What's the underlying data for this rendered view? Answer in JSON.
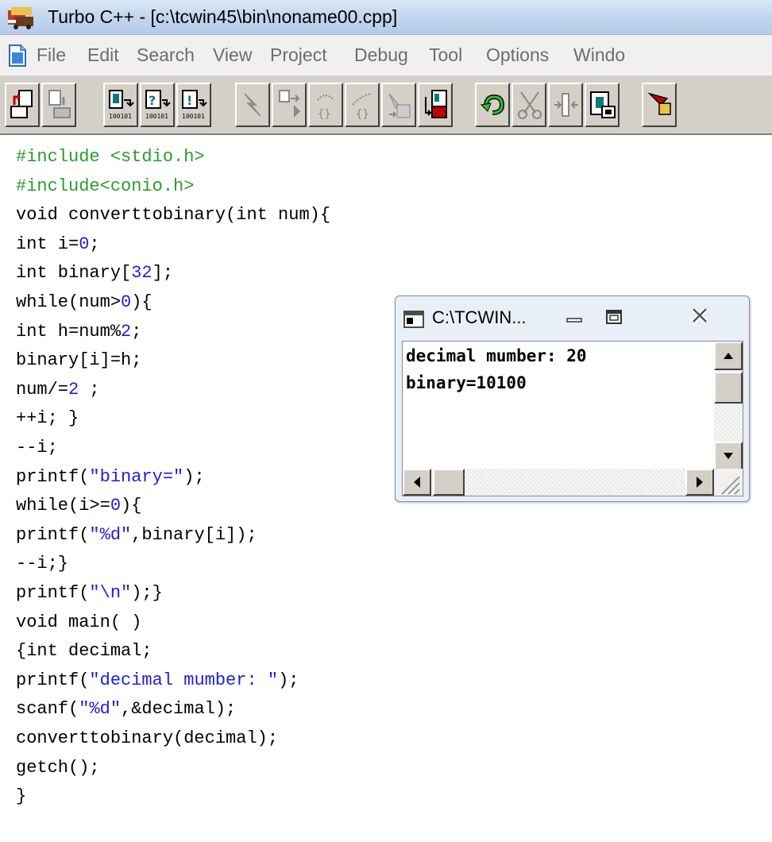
{
  "window": {
    "title": "Turbo C++ - [c:\\tcwin45\\bin\\noname00.cpp]"
  },
  "menu": [
    {
      "label": "File"
    },
    {
      "label": "Edit"
    },
    {
      "label": "Search"
    },
    {
      "label": "View"
    },
    {
      "label": "Project"
    },
    {
      "label": "Debug"
    },
    {
      "label": "Tool"
    },
    {
      "label": "Options"
    },
    {
      "label": "Windo"
    }
  ],
  "toolbar": {
    "buttons": [
      "open-icon",
      "save-icon",
      "compile-icon",
      "help-icon",
      "run-icon",
      "build-icon",
      "step-icon",
      "trace-icon",
      "brace-icon",
      "brace-out-icon",
      "toggle-icon",
      "copy-icon",
      "undo-icon",
      "cut-icon",
      "paste-icon",
      "clipboard-icon",
      "find-icon"
    ]
  },
  "code": {
    "lines": [
      {
        "parts": [
          {
            "t": "#include <stdio.h>",
            "c": "pp"
          }
        ]
      },
      {
        "parts": [
          {
            "t": "#include<conio.h>",
            "c": "pp"
          }
        ]
      },
      {
        "parts": [
          {
            "t": "void converttobinary(int num){",
            "c": ""
          }
        ]
      },
      {
        "parts": [
          {
            "t": "int i=",
            "c": ""
          },
          {
            "t": "0",
            "c": "num"
          },
          {
            "t": ";",
            "c": ""
          }
        ]
      },
      {
        "parts": [
          {
            "t": "int binary[",
            "c": ""
          },
          {
            "t": "32",
            "c": "num"
          },
          {
            "t": "];",
            "c": ""
          }
        ]
      },
      {
        "parts": [
          {
            "t": "while(num>",
            "c": ""
          },
          {
            "t": "0",
            "c": "num"
          },
          {
            "t": "){",
            "c": ""
          }
        ]
      },
      {
        "parts": [
          {
            "t": "int h=num%",
            "c": ""
          },
          {
            "t": "2",
            "c": "num"
          },
          {
            "t": ";",
            "c": ""
          }
        ]
      },
      {
        "parts": [
          {
            "t": "binary[i]=h;",
            "c": ""
          }
        ]
      },
      {
        "parts": [
          {
            "t": "num/=",
            "c": ""
          },
          {
            "t": "2",
            "c": "num"
          },
          {
            "t": " ;",
            "c": ""
          }
        ]
      },
      {
        "parts": [
          {
            "t": "++i; }",
            "c": ""
          }
        ]
      },
      {
        "parts": [
          {
            "t": "--i;",
            "c": ""
          }
        ]
      },
      {
        "parts": [
          {
            "t": "printf(",
            "c": ""
          },
          {
            "t": "\"binary=\"",
            "c": "str"
          },
          {
            "t": ");",
            "c": ""
          }
        ]
      },
      {
        "parts": [
          {
            "t": "while(i>=",
            "c": ""
          },
          {
            "t": "0",
            "c": "num"
          },
          {
            "t": "){",
            "c": ""
          }
        ]
      },
      {
        "parts": [
          {
            "t": "printf(",
            "c": ""
          },
          {
            "t": "\"%d\"",
            "c": "str"
          },
          {
            "t": ",binary[i]);",
            "c": ""
          }
        ]
      },
      {
        "parts": [
          {
            "t": "--i;}",
            "c": ""
          }
        ]
      },
      {
        "parts": [
          {
            "t": "printf(",
            "c": ""
          },
          {
            "t": "\"\\n\"",
            "c": "str"
          },
          {
            "t": ");}",
            "c": ""
          }
        ]
      },
      {
        "parts": [
          {
            "t": "void main( )",
            "c": ""
          }
        ]
      },
      {
        "parts": [
          {
            "t": "{int decimal;",
            "c": ""
          }
        ]
      },
      {
        "parts": [
          {
            "t": "printf(",
            "c": ""
          },
          {
            "t": "\"decimal mumber: \"",
            "c": "str"
          },
          {
            "t": ");",
            "c": ""
          }
        ]
      },
      {
        "parts": [
          {
            "t": "scanf(",
            "c": ""
          },
          {
            "t": "\"%d\"",
            "c": "str"
          },
          {
            "t": ",&decimal);",
            "c": ""
          }
        ]
      },
      {
        "parts": [
          {
            "t": "converttobinary(decimal);",
            "c": ""
          }
        ]
      },
      {
        "parts": [
          {
            "t": "getch();",
            "c": ""
          }
        ]
      },
      {
        "parts": [
          {
            "t": "}",
            "c": ""
          }
        ]
      }
    ]
  },
  "console": {
    "title": "C:\\TCWIN...",
    "output": [
      "decimal mumber: 20",
      "binary=10100"
    ]
  },
  "colors": {
    "preprocessor": "#2a9c2a",
    "string_literal": "#1f1fd6",
    "number_literal": "#1f1fd6"
  }
}
